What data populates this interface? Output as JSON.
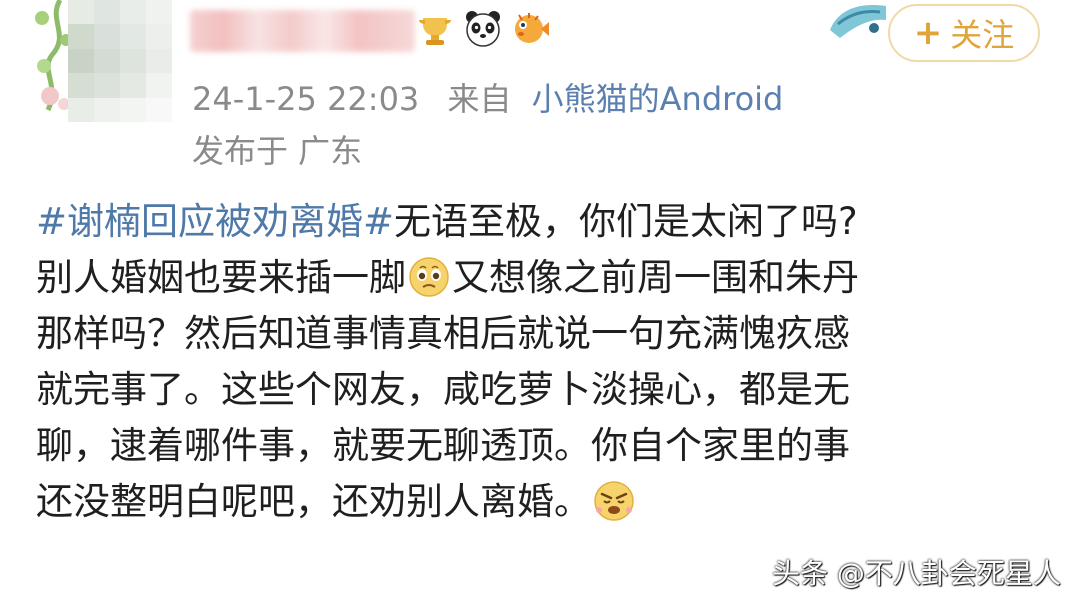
{
  "post": {
    "timestamp": "24-1-25 22:03",
    "source_prefix": "来自",
    "source_app": "小熊猫的Android",
    "location": "发布于 广东",
    "hashtag": "#谢楠回应被劝离婚#",
    "line1_rest": "无语至极，你们是太闲了吗?",
    "line2_a": "别人婚姻也要来插一脚",
    "line2_b": "又想像之前周一围和朱丹",
    "line3": "那样吗？然后知道事情真相后就说一句充满愧疚感",
    "line4": "就完事了。这些个网友，咸吃萝卜淡操心，都是无",
    "line5": "聊，逮着哪件事，就要无聊透顶。你自个家里的事",
    "line6": "还没整明白呢吧，还劝别人离婚。"
  },
  "header": {
    "follow_plus": "+",
    "follow_label": "关注",
    "badges": [
      "trophy-badge-icon",
      "panda-icon",
      "pufferfish-icon"
    ]
  },
  "emojis": {
    "mid_line": "pleading-face-emoji",
    "end_line": "frustrated-face-emoji"
  },
  "watermark": {
    "text": "头条 @不八卦会死星人"
  },
  "colors": {
    "hashtag": "#4e79a8",
    "source_link": "#5b7fae",
    "follow_accent": "#e0a43a",
    "meta_gray": "#8a8a8a"
  }
}
